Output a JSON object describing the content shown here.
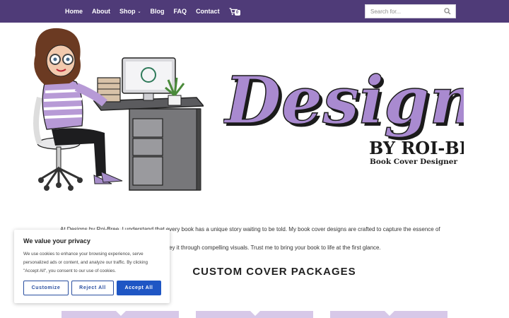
{
  "nav": {
    "items": [
      {
        "label": "Home"
      },
      {
        "label": "About"
      },
      {
        "label": "Shop",
        "has_dropdown": true
      },
      {
        "label": "Blog"
      },
      {
        "label": "FAQ"
      },
      {
        "label": "Contact"
      }
    ],
    "cart_count": "0",
    "cart_icon": "cart-icon",
    "dropdown_icon": "chevron-down-icon"
  },
  "search": {
    "placeholder": "Search for...",
    "value": "",
    "icon": "search-icon"
  },
  "hero": {
    "illustration": "designer-at-desk-illustration",
    "logo": {
      "word": "Designs",
      "sub": "BY ROI-BREE",
      "tagline": "Book Cover Designer"
    }
  },
  "intro": {
    "line1": "At Designs by Roi-Bree, I understand that every book has a unique story waiting to be told. My book cover designs are crafted to capture the essence of your",
    "line2": "ey it through compelling visuals. Trust me to bring your book to life at the first glance."
  },
  "packages": {
    "title": "CUSTOM COVER PACKAGES"
  },
  "cookie": {
    "title": "We value your privacy",
    "text": "We use cookies to enhance your browsing experience, serve personalized ads or content, and analyze our traffic. By clicking \"Accept All\", you consent to our use of cookies.",
    "customize": "Customize",
    "reject": "Reject All",
    "accept": "Accept All"
  },
  "colors": {
    "header": "#4f3b78",
    "logo_purple": "#a98ad0",
    "accent_blue": "#1f56c4",
    "card_top": "#d7c8e8"
  }
}
